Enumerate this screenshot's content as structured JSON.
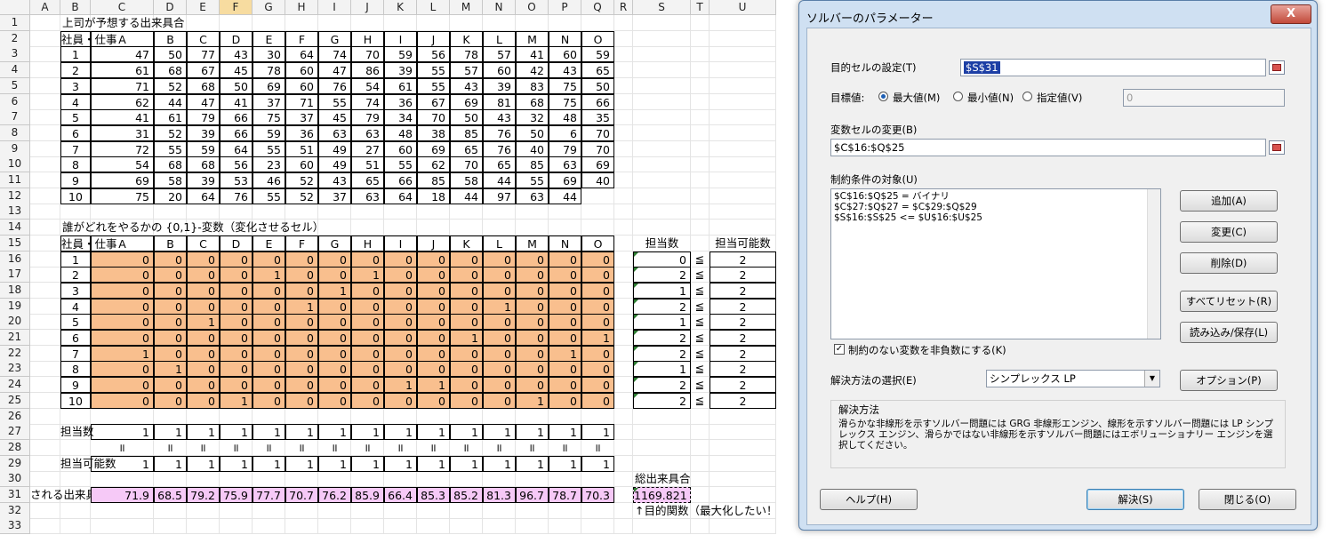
{
  "columns": [
    "A",
    "B",
    "C",
    "D",
    "E",
    "F",
    "G",
    "H",
    "I",
    "J",
    "K",
    "L",
    "M",
    "N",
    "O",
    "P",
    "Q",
    "R",
    "S",
    "T",
    "U"
  ],
  "selected_column": "F",
  "rows": [
    "1",
    "2",
    "3",
    "4",
    "5",
    "6",
    "7",
    "8",
    "9",
    "10",
    "11",
    "12",
    "13",
    "14",
    "15",
    "16",
    "17",
    "18",
    "19",
    "20",
    "21",
    "22",
    "23",
    "24",
    "25",
    "26",
    "27",
    "28",
    "29",
    "30",
    "31",
    "32",
    "33"
  ],
  "sheet": {
    "title1": "上司が予想する出来具合",
    "corner_label": "社員・仕事",
    "jobs": [
      "A",
      "B",
      "C",
      "D",
      "E",
      "F",
      "G",
      "H",
      "I",
      "J",
      "K",
      "L",
      "M",
      "N",
      "O"
    ],
    "employees": [
      "1",
      "2",
      "3",
      "4",
      "5",
      "6",
      "7",
      "8",
      "9",
      "10"
    ],
    "score": [
      [
        "47",
        "50",
        "77",
        "43",
        "30",
        "64",
        "74",
        "70",
        "59",
        "56",
        "78",
        "57",
        "41",
        "60",
        "59"
      ],
      [
        "61",
        "68",
        "67",
        "45",
        "78",
        "60",
        "47",
        "86",
        "39",
        "55",
        "57",
        "60",
        "42",
        "43",
        "65"
      ],
      [
        "71",
        "52",
        "68",
        "50",
        "69",
        "60",
        "76",
        "54",
        "61",
        "55",
        "43",
        "39",
        "83",
        "75",
        "50"
      ],
      [
        "62",
        "44",
        "47",
        "41",
        "37",
        "71",
        "55",
        "74",
        "36",
        "67",
        "69",
        "81",
        "68",
        "75",
        "66"
      ],
      [
        "41",
        "61",
        "79",
        "66",
        "75",
        "37",
        "45",
        "79",
        "34",
        "70",
        "50",
        "43",
        "32",
        "48",
        "35"
      ],
      [
        "31",
        "52",
        "39",
        "66",
        "59",
        "36",
        "63",
        "63",
        "48",
        "38",
        "85",
        "76",
        "50",
        "6",
        "70"
      ],
      [
        "72",
        "55",
        "59",
        "64",
        "55",
        "51",
        "49",
        "27",
        "60",
        "69",
        "65",
        "76",
        "40",
        "79",
        "70"
      ],
      [
        "54",
        "68",
        "68",
        "56",
        "23",
        "60",
        "49",
        "51",
        "55",
        "62",
        "70",
        "65",
        "85",
        "63",
        "69"
      ],
      [
        "69",
        "58",
        "39",
        "53",
        "46",
        "52",
        "43",
        "65",
        "66",
        "85",
        "58",
        "44",
        "55",
        "69",
        "40"
      ],
      [
        "75",
        "20",
        "64",
        "76",
        "55",
        "52",
        "37",
        "63",
        "64",
        "18",
        "44",
        "97",
        "63",
        "44"
      ]
    ],
    "title2": "誰がどれをやるかの {0,1}-変数（変化させるセル）",
    "vars": [
      [
        "0",
        "0",
        "0",
        "0",
        "0",
        "0",
        "0",
        "0",
        "0",
        "0",
        "0",
        "0",
        "0",
        "0",
        "0"
      ],
      [
        "0",
        "0",
        "0",
        "0",
        "1",
        "0",
        "0",
        "1",
        "0",
        "0",
        "0",
        "0",
        "0",
        "0",
        "0"
      ],
      [
        "0",
        "0",
        "0",
        "0",
        "0",
        "0",
        "1",
        "0",
        "0",
        "0",
        "0",
        "0",
        "0",
        "0",
        "0"
      ],
      [
        "0",
        "0",
        "0",
        "0",
        "0",
        "1",
        "0",
        "0",
        "0",
        "0",
        "0",
        "1",
        "0",
        "0",
        "0"
      ],
      [
        "0",
        "0",
        "1",
        "0",
        "0",
        "0",
        "0",
        "0",
        "0",
        "0",
        "0",
        "0",
        "0",
        "0",
        "0"
      ],
      [
        "0",
        "0",
        "0",
        "0",
        "0",
        "0",
        "0",
        "0",
        "0",
        "0",
        "1",
        "0",
        "0",
        "0",
        "1"
      ],
      [
        "1",
        "0",
        "0",
        "0",
        "0",
        "0",
        "0",
        "0",
        "0",
        "0",
        "0",
        "0",
        "0",
        "1",
        "0"
      ],
      [
        "0",
        "1",
        "0",
        "0",
        "0",
        "0",
        "0",
        "0",
        "0",
        "0",
        "0",
        "0",
        "0",
        "0",
        "0"
      ],
      [
        "0",
        "0",
        "0",
        "0",
        "0",
        "0",
        "0",
        "0",
        "1",
        "1",
        "0",
        "0",
        "0",
        "0",
        "0"
      ],
      [
        "0",
        "0",
        "0",
        "1",
        "0",
        "0",
        "0",
        "0",
        "0",
        "0",
        "0",
        "0",
        "1",
        "0",
        "0"
      ]
    ],
    "assign_label": "担当数",
    "capacity_label": "担当可能数",
    "assign_counts": [
      "0",
      "2",
      "1",
      "2",
      "1",
      "2",
      "2",
      "1",
      "2",
      "2"
    ],
    "leq": "≦",
    "capacity": [
      "2",
      "2",
      "2",
      "2",
      "2",
      "2",
      "2",
      "2",
      "2",
      "2"
    ],
    "row27_label": "担当数",
    "row27_values": [
      "1",
      "1",
      "1",
      "1",
      "1",
      "1",
      "1",
      "1",
      "1",
      "1",
      "1",
      "1",
      "1",
      "1",
      "1"
    ],
    "eq_symbol": "॥",
    "row29_label": "担当可能数",
    "row29_values": [
      "1",
      "1",
      "1",
      "1",
      "1",
      "1",
      "1",
      "1",
      "1",
      "1",
      "1",
      "1",
      "1",
      "1",
      "1"
    ],
    "row31_label": "される出来具合",
    "row31_values": [
      "71.9",
      "68.5",
      "79.2",
      "75.9",
      "77.7",
      "70.7",
      "76.2",
      "85.9",
      "66.4",
      "85.3",
      "85.2",
      "81.3",
      "96.7",
      "78.7",
      "70.3"
    ],
    "total_label": "総出来具合",
    "total_value": "1169.821",
    "objective_note": "↑目的関数（最大化したい！"
  },
  "dialog": {
    "title": "ソルバーのパラメーター",
    "close": "X",
    "objective_label": "目的セルの設定(T)",
    "objective_value": "$S$31",
    "target_label": "目標値:",
    "opt_max": "最大値(M)",
    "opt_min": "最小値(N)",
    "opt_value": "指定値(V)",
    "target_value": "0",
    "var_label": "変数セルの変更(B)",
    "var_value": "$C$16:$Q$25",
    "constraints_label": "制約条件の対象(U)",
    "constraints": [
      "$C$16:$Q$25 = バイナリ",
      "$C$27:$Q$27 = $C$29:$Q$29",
      "$S$16:$S$25 <= $U$16:$U$25"
    ],
    "btn_add": "追加(A)",
    "btn_change": "変更(C)",
    "btn_delete": "削除(D)",
    "btn_reset": "すべてリセット(R)",
    "btn_loadsave": "読み込み/保存(L)",
    "nonneg_label": "制約のない変数を非負数にする(K)",
    "method_label": "解決方法の選択(E)",
    "method_value": "シンプレックス LP",
    "btn_options": "オプション(P)",
    "method_group": "解決方法",
    "method_desc": "滑らかな非線形を示すソルバー問題には GRG 非線形エンジン、線形を示すソルバー問題には LP シンプレックス エンジン、滑らかではない非線形を示すソルバー問題にはエボリューショナリー エンジンを選択してください。",
    "btn_help": "ヘルプ(H)",
    "btn_solve": "解決(S)",
    "btn_close": "閉じる(O)"
  }
}
